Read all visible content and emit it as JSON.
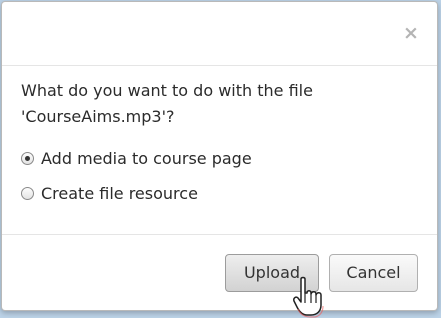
{
  "dialog": {
    "close_symbol": "×",
    "question_line1": "What do you want to do with the file",
    "question_line2": "'CourseAims.mp3'?",
    "options": [
      {
        "label": "Add media to course page",
        "checked": true
      },
      {
        "label": "Create file resource",
        "checked": false
      }
    ],
    "buttons": {
      "upload_label": "Upload",
      "cancel_label": "Cancel"
    }
  },
  "icons": {
    "close": "close-icon",
    "cursor": "hand-pointer-cursor-icon"
  },
  "colors": {
    "backdrop": "#bcd3e8",
    "dialog_bg": "#ffffff",
    "text": "#2b2b2b",
    "close": "#b4b4b4"
  }
}
